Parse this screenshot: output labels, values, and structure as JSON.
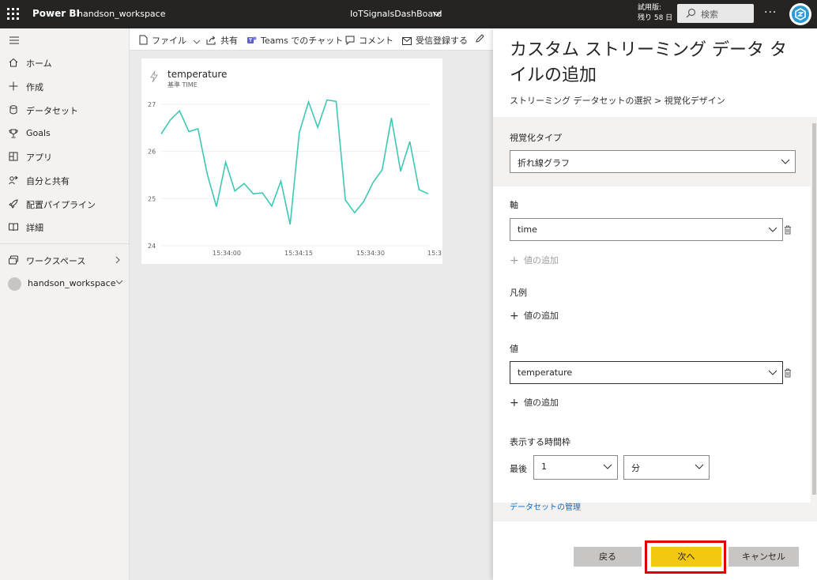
{
  "topbar": {
    "brand": "Power BI",
    "workspace": "handson_workspace",
    "dashboard": "IoTSignalsDashBoard",
    "trial_line1": "試用版:",
    "trial_line2": "残り 58 日",
    "search_placeholder": "検索",
    "more": "···"
  },
  "nav": {
    "items": [
      {
        "label": "ホーム",
        "icon": "home-icon"
      },
      {
        "label": "作成",
        "icon": "plus-icon"
      },
      {
        "label": "データセット",
        "icon": "database-icon"
      },
      {
        "label": "Goals",
        "icon": "trophy-icon"
      },
      {
        "label": "アプリ",
        "icon": "apps-icon"
      },
      {
        "label": "自分と共有",
        "icon": "shared-icon"
      },
      {
        "label": "配置パイプライン",
        "icon": "rocket-icon"
      },
      {
        "label": "詳細",
        "icon": "book-icon"
      }
    ],
    "workspaces_label": "ワークスペース",
    "current_workspace": "handson_workspace"
  },
  "actionbar": {
    "file": "ファイル",
    "share": "共有",
    "teams": "Teams でのチャット",
    "comment": "コメント",
    "subscribe": "受信登録する"
  },
  "tile": {
    "title": "temperature",
    "subtitle": "基準 TIME"
  },
  "chart_data": {
    "type": "line",
    "title": "temperature",
    "subtitle": "基準 TIME",
    "ylim": [
      24,
      27.3
    ],
    "yticks": [
      24,
      25,
      26,
      27
    ],
    "xticks": [
      "15:34:00",
      "15:34:15",
      "15:34:30",
      "15:3"
    ],
    "color": "#3cc8b4",
    "series": [
      {
        "name": "temperature",
        "values": [
          26.37,
          26.67,
          26.86,
          26.42,
          26.48,
          25.52,
          24.83,
          25.77,
          25.16,
          25.32,
          25.1,
          25.12,
          24.84,
          25.37,
          24.45,
          26.4,
          27.05,
          26.51,
          27.09,
          27.06,
          24.97,
          24.7,
          24.94,
          25.34,
          25.61,
          26.71,
          25.58,
          26.21,
          25.19,
          25.1
        ]
      }
    ]
  },
  "panel": {
    "title": "カスタム ストリーミング データ タイルの追加",
    "breadcrumb": "ストリーミング データセットの選択 > 視覚化デザイン",
    "viz_type_label": "視覚化タイプ",
    "viz_type_value": "折れ線グラフ",
    "axis_label": "軸",
    "axis_value": "time",
    "add_value": "値の追加",
    "legend_label": "凡例",
    "values_label": "値",
    "values_value": "temperature",
    "time_window_label": "表示する時間枠",
    "last_label": "最後",
    "last_number": "1",
    "last_unit": "分",
    "manage_link": "データセットの管理",
    "back": "戻る",
    "next": "次へ",
    "cancel": "キャンセル"
  },
  "colors": {
    "topbar": "#252423",
    "accent_yellow": "#f2c811",
    "line": "#3cc8b4",
    "highlight": "#e00000"
  }
}
